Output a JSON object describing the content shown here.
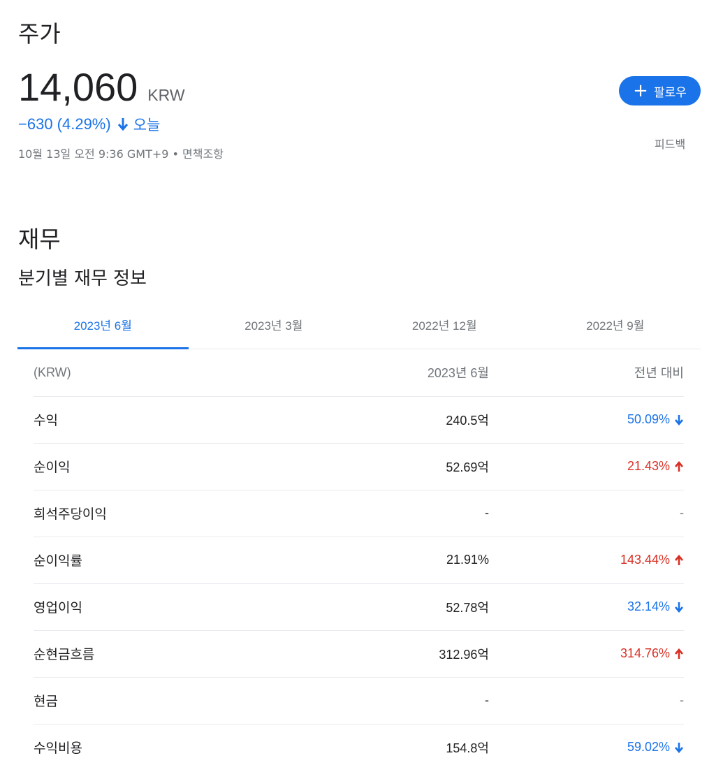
{
  "stock": {
    "title": "주가",
    "price": "14,060",
    "currency": "KRW",
    "change": "−630 (4.29%)",
    "period": "오늘",
    "timestamp": "10월 13일 오전 9:36 GMT+9",
    "separator": " • ",
    "disclaimer": "면책조항",
    "follow_label": "팔로우",
    "feedback": "피드백",
    "colors": {
      "down": "#1a73e8",
      "up": "#d93025",
      "accent": "#1a73e8"
    }
  },
  "financials": {
    "title": "재무",
    "subtitle": "분기별 재무 정보",
    "tabs": [
      "2023년 6월",
      "2023년 3월",
      "2022년 12월",
      "2022년 9월"
    ],
    "active_tab": 0,
    "headers": {
      "label": "(KRW)",
      "value": "2023년 6월",
      "yoy": "전년 대비"
    },
    "rows": [
      {
        "label": "수익",
        "value": "240.5억",
        "yoy": "50.09%",
        "dir": "down"
      },
      {
        "label": "순이익",
        "value": "52.69억",
        "yoy": "21.43%",
        "dir": "up"
      },
      {
        "label": "희석주당이익",
        "value": "-",
        "yoy": "-",
        "dir": "none"
      },
      {
        "label": "순이익률",
        "value": "21.91%",
        "yoy": "143.44%",
        "dir": "up"
      },
      {
        "label": "영업이익",
        "value": "52.78억",
        "yoy": "32.14%",
        "dir": "down"
      },
      {
        "label": "순현금흐름",
        "value": "312.96억",
        "yoy": "314.76%",
        "dir": "up"
      },
      {
        "label": "현금",
        "value": "-",
        "yoy": "-",
        "dir": "none"
      },
      {
        "label": "수익비용",
        "value": "154.8억",
        "yoy": "59.02%",
        "dir": "down"
      }
    ]
  }
}
